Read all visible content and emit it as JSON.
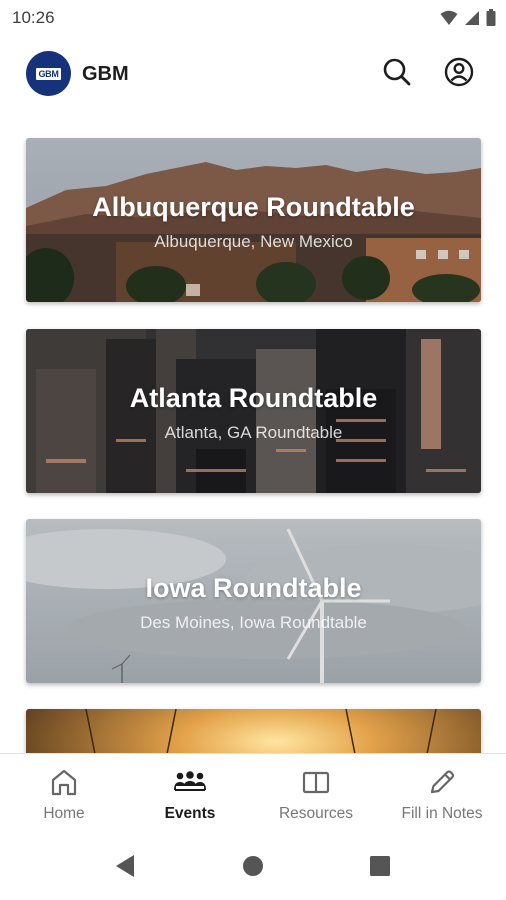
{
  "status_bar": {
    "time": "10:26",
    "icons": [
      "wifi-icon",
      "signal-icon",
      "battery-icon"
    ]
  },
  "header": {
    "logo_text": "GBM",
    "app_name": "GBM",
    "actions": [
      "search-icon",
      "account-icon"
    ]
  },
  "events": [
    {
      "title": "Albuquerque Roundtable",
      "subtitle": "Albuquerque, New Mexico"
    },
    {
      "title": "Atlanta Roundtable",
      "subtitle": "Atlanta, GA Roundtable"
    },
    {
      "title": "Iowa Roundtable",
      "subtitle": "Des Moines, Iowa Roundtable"
    }
  ],
  "bottom_nav": {
    "items": [
      {
        "label": "Home",
        "icon": "home-icon"
      },
      {
        "label": "Events",
        "icon": "people-group-icon",
        "active": true
      },
      {
        "label": "Resources",
        "icon": "book-icon"
      },
      {
        "label": "Fill in Notes",
        "icon": "pencil-icon"
      }
    ]
  },
  "colors": {
    "brand": "#16327a",
    "active_nav": "#1b1b1b",
    "inactive_nav": "#777777"
  }
}
